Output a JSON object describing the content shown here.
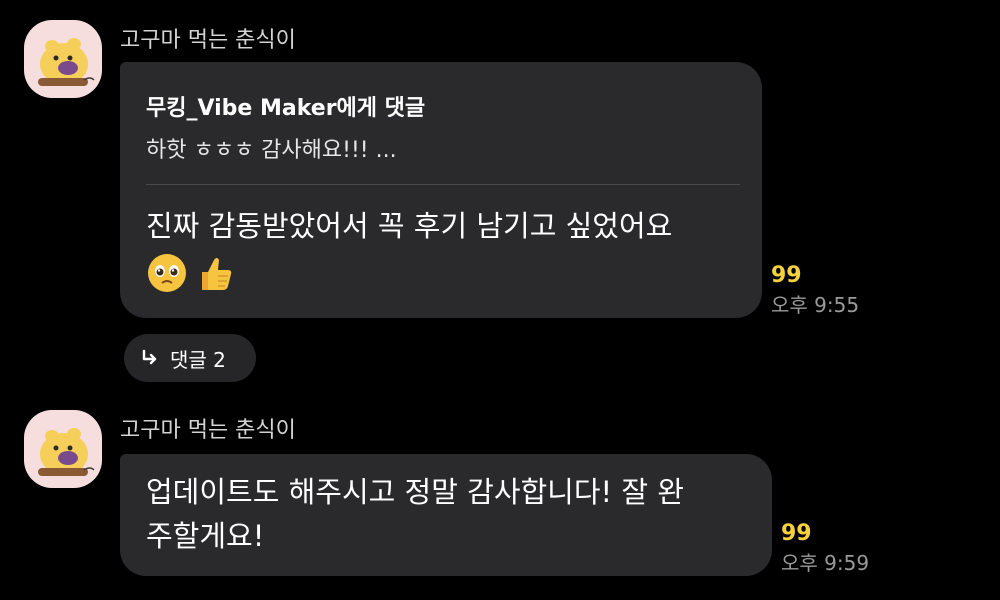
{
  "messages": [
    {
      "sender": "고구마 먹는 춘식이",
      "reply": {
        "title": "무킹_Vibe Maker에게 댓글",
        "snippet": "하핫 ㅎㅎㅎ 감사해요!!! ..."
      },
      "text_lines": [
        "진짜 감동받았어서 꼭 후기 남기고 싶었어요"
      ],
      "emojis": [
        "pleading-face-emoji",
        "thumbs-up-emoji"
      ],
      "reaction_count": "99",
      "time": "오후 9:55",
      "thread_replies": {
        "label": "댓글 2",
        "icon": "reply-arrow-icon"
      }
    },
    {
      "sender": "고구마 먹는 춘식이",
      "text_lines": [
        "업데이트도 해주시고 정말 감사합니다! 잘 완",
        "주할게요!"
      ],
      "reaction_count": "99",
      "time": "오후 9:59"
    }
  ],
  "colors": {
    "background": "#000000",
    "bubble": "#2a2a2c",
    "reaction_count": "#f5d23c",
    "time": "#9a9a9a",
    "avatar_bg": "#f7dede"
  }
}
